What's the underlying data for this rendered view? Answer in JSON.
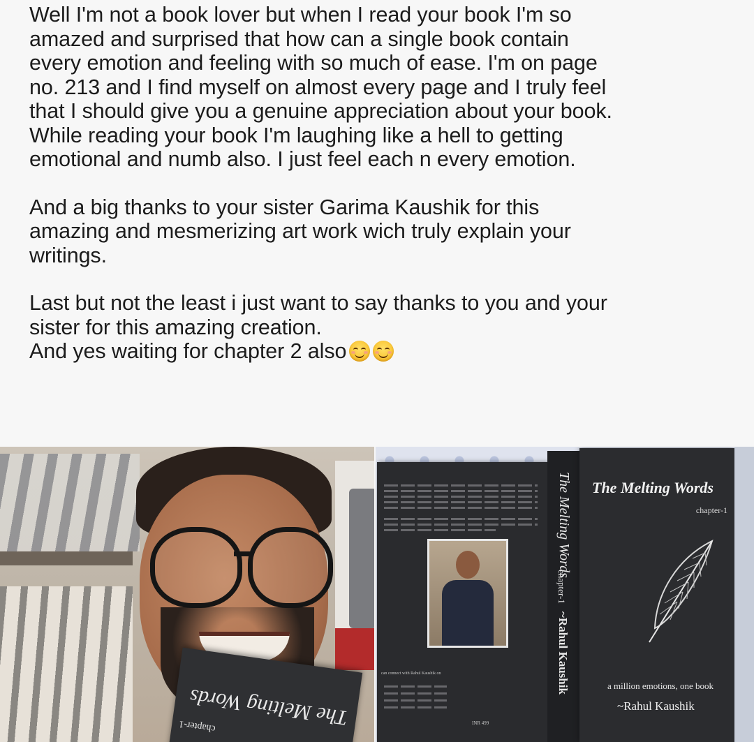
{
  "post": {
    "paragraph_1": "Well I'm not a book lover but when I read your book I'm so\namazed and surprised that how can a single book contain\nevery emotion and feeling with so much of ease. I'm on page\nno. 213 and I find myself on almost every page and I truly feel\nthat I should give you a genuine appreciation about your book.\nWhile reading your book I'm laughing like a hell to getting\nemotional and numb also. I just feel each n every emotion.",
    "paragraph_2": "And a big thanks to your sister Garima Kaushik for this\namazing and mesmerizing art work wich truly explain your\nwritings.",
    "paragraph_3": "Last but not the least i just want to say thanks to you and your\nsister for this amazing creation.",
    "paragraph_4": "And yes waiting for chapter 2 also",
    "emoji": "smiling-face-with-smiling-eyes-icon"
  },
  "photo_left": {
    "book_title": "The Melting Words",
    "book_chapter": "chapter-1"
  },
  "photo_right": {
    "front_title": "The Melting Words",
    "front_chapter": "chapter-1",
    "front_tagline": "a million emotions, one book",
    "front_author": "~Rahul Kaushik",
    "spine_title": "The Melting Words",
    "spine_chapter": "chapter-1",
    "spine_author": "~Rahul Kaushik",
    "back_contact": "can connect with Rahul Kaushik on",
    "back_price": "INR 499"
  },
  "colors": {
    "background": "#f7f7f7",
    "text": "#1c1c1c",
    "book_cover": "#2b2c2f"
  }
}
